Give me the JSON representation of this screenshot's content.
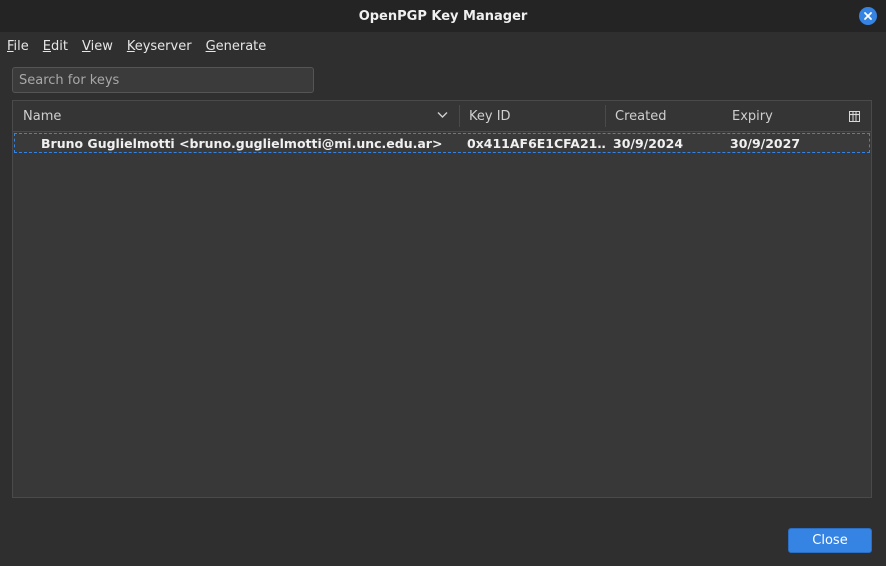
{
  "window": {
    "title": "OpenPGP Key Manager"
  },
  "menu": {
    "items": [
      {
        "mnemonic": "F",
        "rest": "ile"
      },
      {
        "mnemonic": "E",
        "rest": "dit"
      },
      {
        "mnemonic": "V",
        "rest": "iew"
      },
      {
        "mnemonic": "K",
        "rest": "eyserver"
      },
      {
        "mnemonic": "G",
        "rest": "enerate"
      }
    ]
  },
  "search": {
    "placeholder": "Search for keys",
    "value": ""
  },
  "table": {
    "columns": {
      "name": "Name",
      "key_id": "Key ID",
      "created": "Created",
      "expiry": "Expiry"
    },
    "rows": [
      {
        "name": "Bruno Guglielmotti <bruno.guglielmotti@mi.unc.edu.ar>",
        "key_id": "0x411AF6E1CFA21…",
        "created": "30/9/2024",
        "expiry": "30/9/2027"
      }
    ]
  },
  "footer": {
    "close_label": "Close"
  },
  "colors": {
    "accent": "#3584e4",
    "background": "#2f2f2f",
    "titlebar": "#242424"
  },
  "icons": {
    "window_close": "close-icon",
    "sort": "chevron-down-icon",
    "column_picker": "column-picker-icon"
  }
}
